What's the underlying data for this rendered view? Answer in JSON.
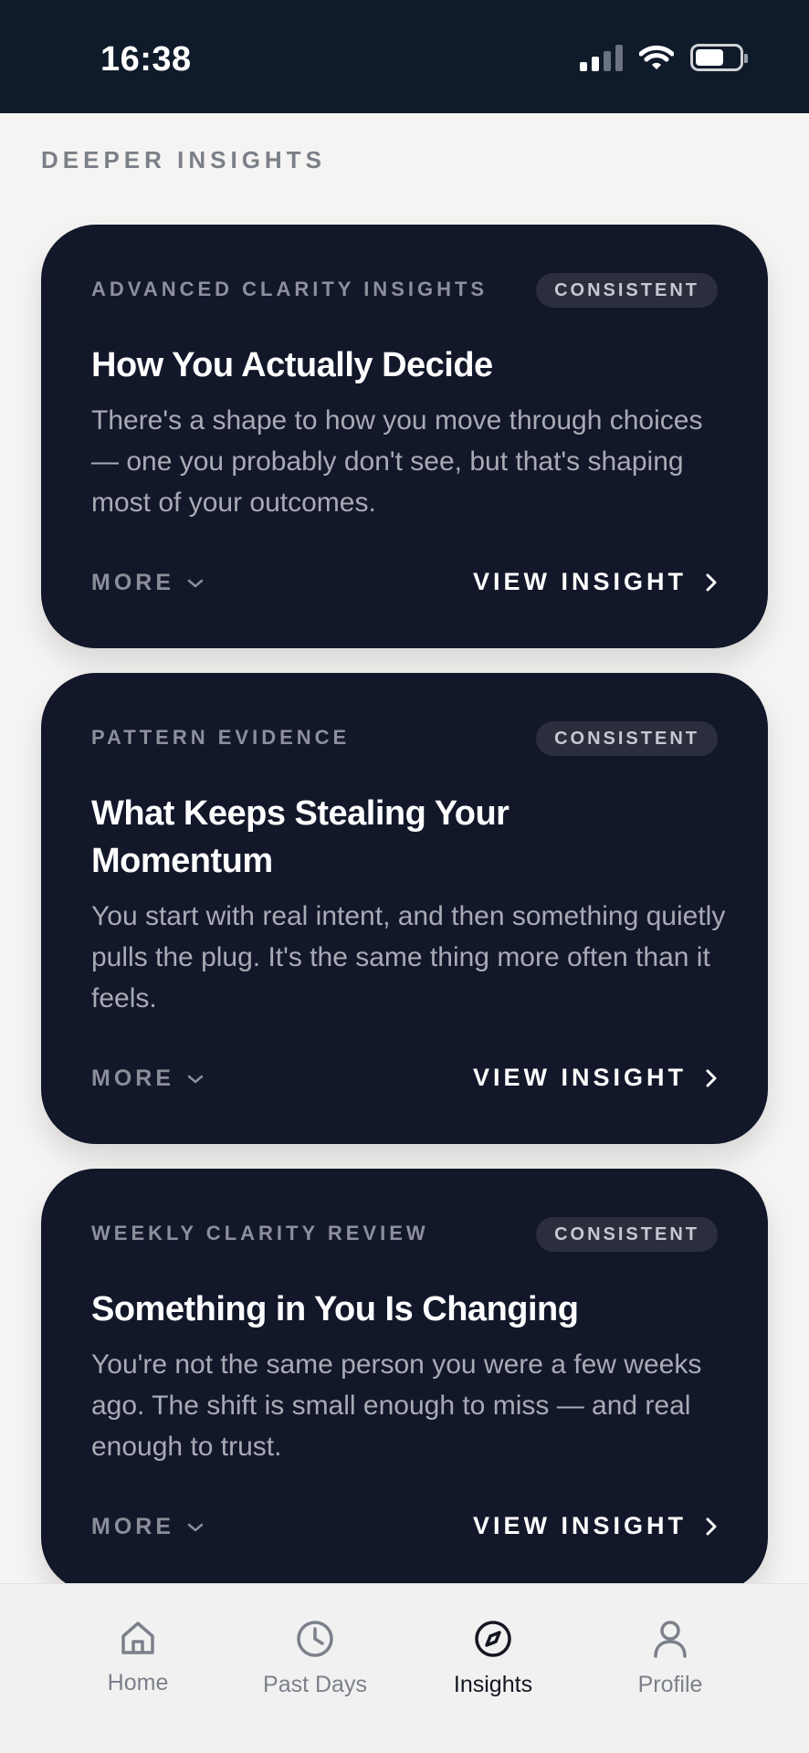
{
  "status_bar": {
    "time": "16:38"
  },
  "section": {
    "label": "DEEPER INSIGHTS"
  },
  "cards": [
    {
      "eyebrow": "ADVANCED CLARITY INSIGHTS",
      "badge": "CONSISTENT",
      "title": "How You Actually Decide",
      "description": "There's a shape to how you move through choices — one you probably don't see, but that's shaping most of your outcomes.",
      "more_label": "MORE",
      "view_label": "VIEW INSIGHT"
    },
    {
      "eyebrow": "PATTERN EVIDENCE",
      "badge": "CONSISTENT",
      "title": "What Keeps Stealing Your Momentum",
      "description": "You start with real intent, and then something quietly pulls the plug. It's the same thing more often than it feels.",
      "more_label": "MORE",
      "view_label": "VIEW INSIGHT"
    },
    {
      "eyebrow": "WEEKLY CLARITY REVIEW",
      "badge": "CONSISTENT",
      "title": "Something in You Is Changing",
      "description": "You're not the same person you were a few weeks ago. The shift is small enough to miss — and real enough to trust.",
      "more_label": "MORE",
      "view_label": "VIEW INSIGHT"
    }
  ],
  "tab_bar": {
    "active": "Insights",
    "tabs": [
      {
        "label": "Home",
        "icon": "home-icon"
      },
      {
        "label": "Past Days",
        "icon": "clock-icon"
      },
      {
        "label": "Insights",
        "icon": "compass-icon"
      },
      {
        "label": "Profile",
        "icon": "person-icon"
      }
    ]
  },
  "colors": {
    "status_bar_bg": "#0f1a2a",
    "card_bg": "#13172a",
    "page_bg": "#f5f4f2"
  }
}
